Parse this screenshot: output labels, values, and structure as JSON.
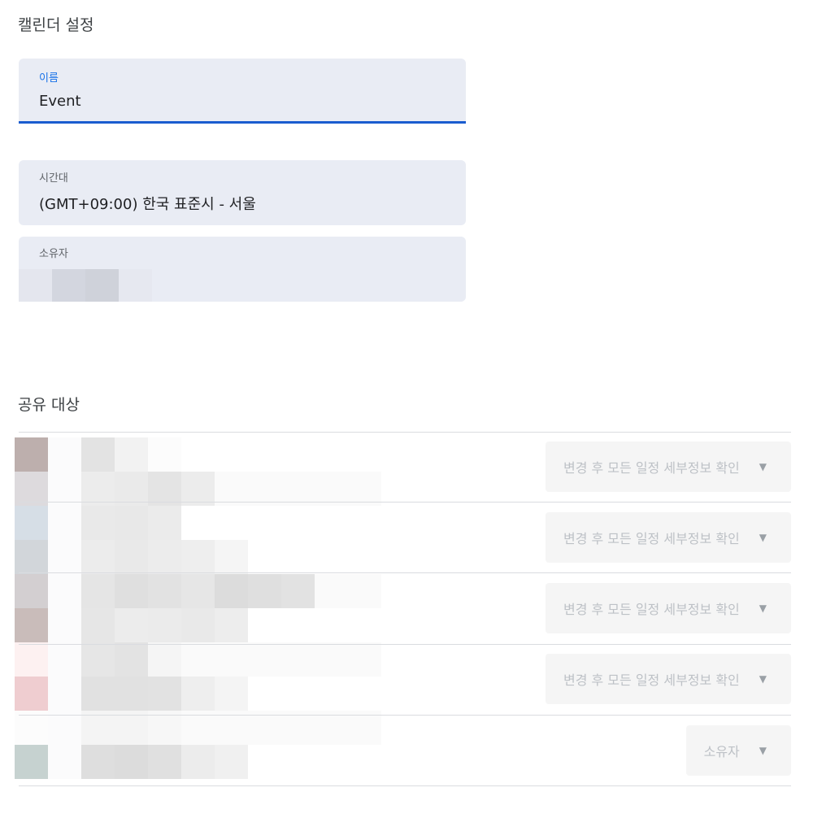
{
  "settings": {
    "title": "캘린더 설정",
    "name_label": "이름",
    "name_value": "Event",
    "timezone_label": "시간대",
    "timezone_value": "(GMT+09:00) 한국 표준시 - 서울",
    "owner_label": "소유자"
  },
  "sharing": {
    "title": "공유 대상",
    "members": [
      {
        "permission": "변경 후 모든 일정 세부정보 확인"
      },
      {
        "permission": "변경 후 모든 일정 세부정보 확인"
      },
      {
        "permission": "변경 후 모든 일정 세부정보 확인"
      },
      {
        "permission": "변경 후 모든 일정 세부정보 확인"
      },
      {
        "permission": "소유자"
      }
    ],
    "dropdown_icon": "caret-down-icon"
  },
  "colors": {
    "accent": "#1a73e8",
    "field_bg": "#e9ecf4",
    "disabled_text": "#bdc1c6"
  }
}
